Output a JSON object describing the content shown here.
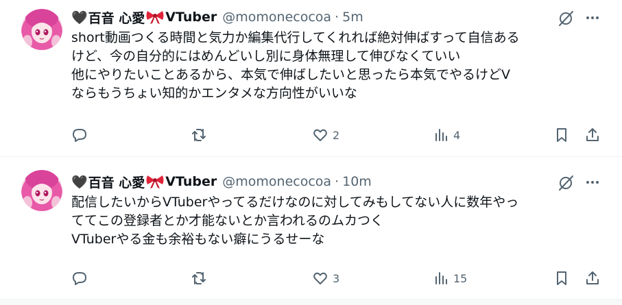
{
  "tweets": [
    {
      "author": {
        "name_prefix": "百音 心愛",
        "name_suffix": "VTuber",
        "handle": "@momonecocoa"
      },
      "separator": "·",
      "time": "5m",
      "lines": [
        "short動画つくる時間と気力か編集代行してくれれば絶対伸ばすって自信ある",
        "けど、今の自分的にはめんどいし別に身体無理して伸びなくていい",
        "他にやりたいことあるから、本気で伸ばしたいと思ったら本気でやるけどV",
        "ならもうちょい知的かエンタメな方向性がいいな"
      ],
      "stats": {
        "replies": "",
        "reposts": "",
        "likes": "2",
        "views": "4"
      }
    },
    {
      "author": {
        "name_prefix": "百音 心愛",
        "name_suffix": "VTuber",
        "handle": "@momonecocoa"
      },
      "separator": "·",
      "time": "10m",
      "lines": [
        "配信したいからVTuberやってるだけなのに対してみもしてない人に数年やっ",
        "ててこの登録者とか才能ないとか言われるのムカつく",
        "VTuberやる金も余裕もない癖にうるせーな"
      ],
      "stats": {
        "replies": "",
        "reposts": "",
        "likes": "3",
        "views": "15"
      }
    }
  ],
  "icons": {
    "heart_emoji": "black-heart-icon",
    "bow_emoji": "red-ribbon-icon",
    "grok": "grok-icon",
    "more": "more-icon",
    "reply": "reply-icon",
    "repost": "repost-icon",
    "like": "like-icon",
    "views": "views-icon",
    "bookmark": "bookmark-icon",
    "share": "share-icon"
  },
  "colors": {
    "text": "#0f1419",
    "secondary": "#536471",
    "divider": "#eff3f4",
    "avatar_pink": "#e85aa8",
    "bow_red": "#e0243a"
  }
}
